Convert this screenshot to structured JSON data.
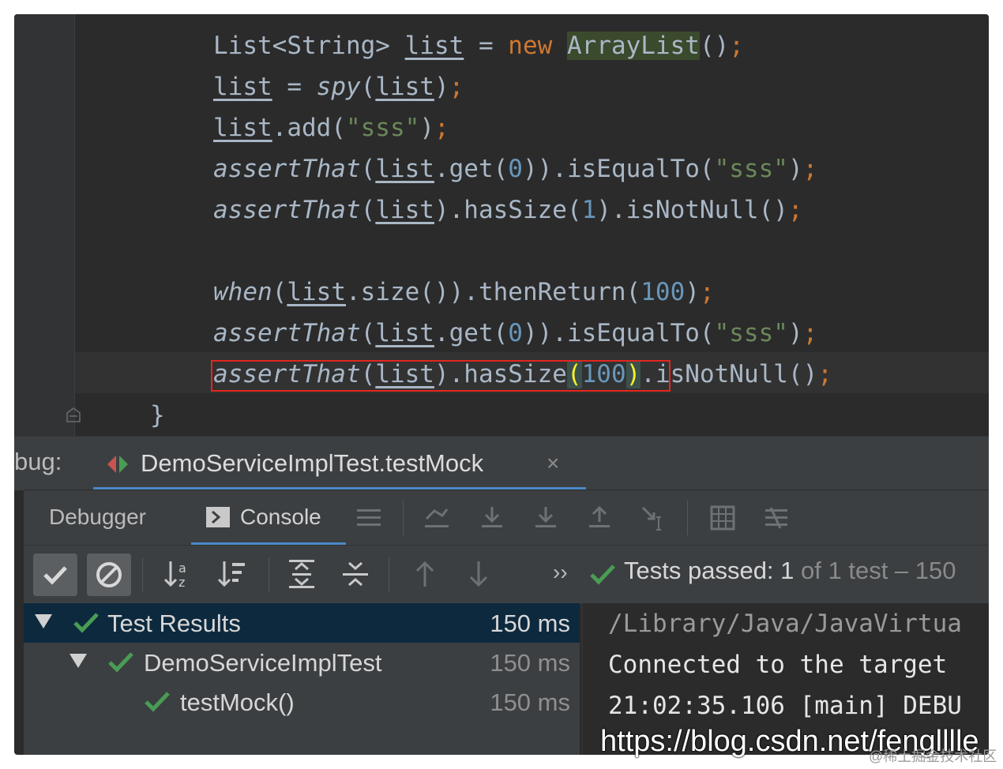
{
  "editor": {
    "lines": {
      "l1": {
        "a": "List<String> ",
        "b": "list",
        "c": " = ",
        "d": "new",
        "e": " ",
        "f": "ArrayList",
        "g": "()",
        "h": ";"
      },
      "l2": {
        "a": "list",
        "b": " = ",
        "c": "spy",
        "d": "(",
        "e": "list",
        "f": ")",
        "g": ";"
      },
      "l3": {
        "a": "list",
        "b": ".add(",
        "c": "\"sss\"",
        "d": ")",
        "e": ";"
      },
      "l4": {
        "a": "assertThat",
        "b": "(",
        "c": "list",
        "d": ".get(",
        "e": "0",
        "f": ")).isEqualTo(",
        "g": "\"sss\"",
        "h": ")",
        "i": ";"
      },
      "l5": {
        "a": "assertThat",
        "b": "(",
        "c": "list",
        "d": ").hasSize(",
        "e": "1",
        "f": ").isNotNull()",
        "g": ";"
      },
      "l6": {
        "a": "when",
        "b": "(",
        "c": "list",
        "d": ".size()).thenReturn(",
        "e": "100",
        "f": ")",
        "g": ";"
      },
      "l7": {
        "a": "assertThat",
        "b": "(",
        "c": "list",
        "d": ".get(",
        "e": "0",
        "f": ")).isEqualTo(",
        "g": "\"sss\"",
        "h": ")",
        "i": ";"
      },
      "l8": {
        "a": "assertThat",
        "b": "(",
        "c": "list",
        "d": ").hasSize",
        "e": "(",
        "f": "100",
        "g": ")",
        "h": ".isNotNull()",
        "i": ";"
      },
      "l9": {
        "a": "}"
      }
    }
  },
  "debug_tabs": {
    "prefix": "bug:",
    "active_tab": "DemoServiceImplTest.testMock",
    "close_glyph": "×"
  },
  "toolbar": {
    "debugger_label": "Debugger",
    "console_label": "Console"
  },
  "test_toolbar": {
    "more_glyph": "››",
    "summary_passed": "Tests passed: 1",
    "summary_rest": " of 1 test – 150"
  },
  "tree": {
    "rows": [
      {
        "label": "Test Results",
        "time": "150 ms"
      },
      {
        "label": "DemoServiceImplTest",
        "time": "150 ms"
      },
      {
        "label": "testMock()",
        "time": "150 ms"
      }
    ]
  },
  "console": {
    "lines": [
      "/Library/Java/JavaVirtua",
      "Connected to the target ",
      "21:02:35.106 [main] DEBU"
    ]
  },
  "watermark": {
    "url": "https://blog.csdn.net/fenglllle",
    "community": "@稀土掘金技术社区"
  },
  "colors": {
    "editor_bg": "#2b2b2b",
    "keyword": "#cc7832",
    "string": "#6a8759",
    "number": "#6897bb",
    "pass_green": "#499c54",
    "selection": "#0d293e",
    "error_box": "#e3261f"
  }
}
